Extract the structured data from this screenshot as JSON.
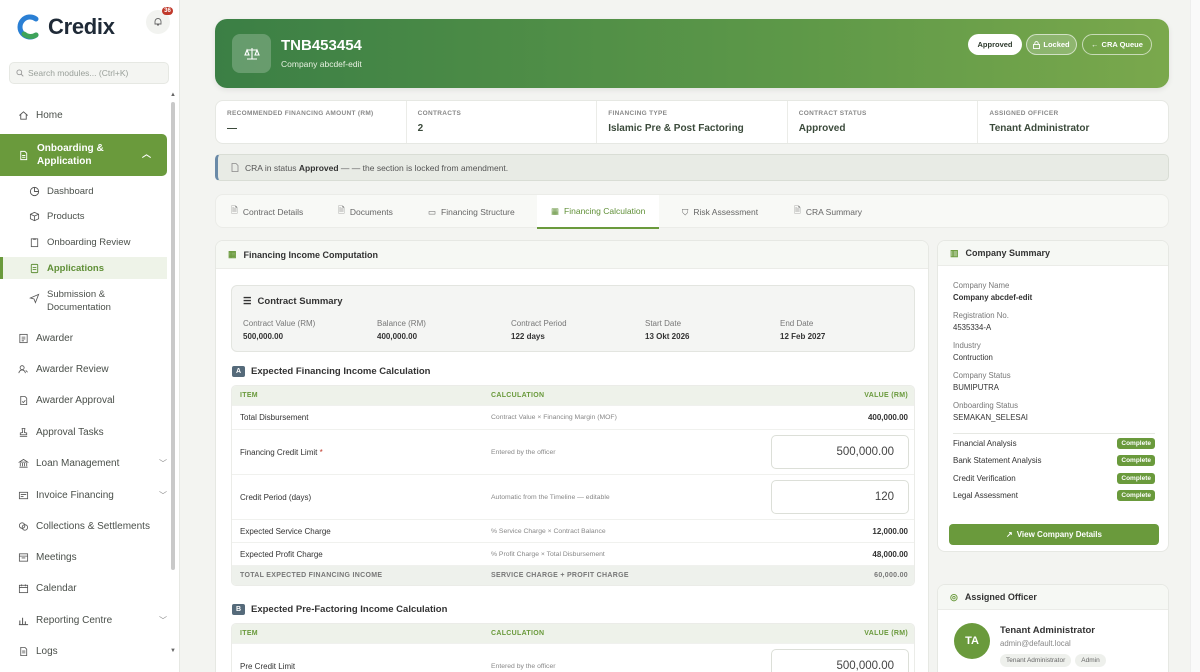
{
  "brand": {
    "name": "Credix",
    "notification_count": "36"
  },
  "search": {
    "placeholder": "Search modules... (Ctrl+K)"
  },
  "nav": {
    "home": "Home",
    "group_active": "Onboarding & Application",
    "sub": {
      "dashboard": "Dashboard",
      "products": "Products",
      "onboarding_review": "Onboarding Review",
      "applications": "Applications",
      "submission": "Submission & Documentation"
    },
    "awarder": "Awarder",
    "awarder_review": "Awarder Review",
    "awarder_approval": "Awarder Approval",
    "approval_tasks": "Approval Tasks",
    "loan_management": "Loan Management",
    "invoice_financing": "Invoice Financing",
    "collections": "Collections & Settlements",
    "meetings": "Meetings",
    "calendar": "Calendar",
    "reporting": "Reporting Centre",
    "logs": "Logs"
  },
  "hero": {
    "title": "TNB453454",
    "subtitle": "Company abcdef-edit",
    "approved_btn": "Approved",
    "locked_btn": "Locked",
    "queue_btn": "CRA Queue"
  },
  "stats": [
    {
      "label": "RECOMMENDED FINANCING AMOUNT (RM)",
      "value": "—"
    },
    {
      "label": "CONTRACTS",
      "value": "2"
    },
    {
      "label": "FINANCING TYPE",
      "value": "Islamic Pre & Post Factoring"
    },
    {
      "label": "CONTRACT STATUS",
      "value": "Approved"
    },
    {
      "label": "ASSIGNED OFFICER",
      "value": "Tenant Administrator"
    }
  ],
  "notice": {
    "prefix": "CRA in status",
    "status": "Approved",
    "suffix": "— — the section is locked from amendment."
  },
  "tabs": [
    "Contract Details",
    "Documents",
    "Financing Structure",
    "Financing Calculation",
    "Risk Assessment",
    "CRA Summary"
  ],
  "main": {
    "title": "Financing Income Computation",
    "contract_summary": {
      "title": "Contract Summary",
      "cols": [
        {
          "label": "Contract Value (RM)",
          "value": "500,000.00"
        },
        {
          "label": "Balance (RM)",
          "value": "400,000.00"
        },
        {
          "label": "Contract Period",
          "value": "122 days"
        },
        {
          "label": "Start Date",
          "value": "13 Okt 2026"
        },
        {
          "label": "End Date",
          "value": "12 Feb 2027"
        }
      ]
    },
    "section_a": {
      "badge": "A",
      "title": "Expected Financing Income Calculation",
      "headers": [
        "ITEM",
        "CALCULATION",
        "VALUE (RM)"
      ],
      "rows": [
        {
          "item": "Total Disbursement",
          "calc": "Contract Value × Financing Margin (MOF)",
          "value": "400,000.00"
        },
        {
          "item": "Financing Credit Limit",
          "calc": "Entered by the officer",
          "value": "500,000.00"
        },
        {
          "item": "Credit Period (days)",
          "calc": "Automatic from the Timeline — editable",
          "value": "120"
        },
        {
          "item": "Expected Service Charge",
          "calc": "% Service Charge × Contract Balance",
          "value": "12,000.00"
        },
        {
          "item": "Expected Profit Charge",
          "calc": "% Profit Charge × Total Disbursement",
          "value": "48,000.00"
        }
      ],
      "total": {
        "item": "TOTAL EXPECTED FINANCING INCOME",
        "calc": "SERVICE CHARGE + PROFIT CHARGE",
        "value": "60,000.00"
      }
    },
    "section_b": {
      "badge": "B",
      "title": "Expected Pre-Factoring Income Calculation",
      "headers": [
        "ITEM",
        "CALCULATION",
        "VALUE (RM)"
      ],
      "rows": [
        {
          "item": "Pre Credit Limit",
          "calc": "Entered by the officer",
          "value": "500,000.00"
        }
      ]
    }
  },
  "company": {
    "title": "Company Summary",
    "fields": [
      {
        "label": "Company Name",
        "value": "Company abcdef-edit"
      },
      {
        "label": "Registration No.",
        "value": "4535334-A"
      },
      {
        "label": "Industry",
        "value": "Contruction"
      },
      {
        "label": "Company Status",
        "value": "BUMIPUTRA"
      },
      {
        "label": "Onboarding Status",
        "value": "SEMAKAN_SELESAI"
      }
    ],
    "checks": [
      {
        "label": "Financial Analysis",
        "status": "Complete"
      },
      {
        "label": "Bank Statement Analysis",
        "status": "Complete"
      },
      {
        "label": "Credit Verification",
        "status": "Complete"
      },
      {
        "label": "Legal Assessment",
        "status": "Complete"
      }
    ],
    "button": "View Company Details"
  },
  "officer": {
    "title": "Assigned Officer",
    "initials": "TA",
    "name": "Tenant Administrator",
    "email": "admin@default.local",
    "tags": [
      "Tenant Administrator",
      "Admin"
    ]
  },
  "colors": {
    "accent": "#6a9a3c",
    "hero_start": "#3b7f45",
    "hero_end": "#7aa84c"
  }
}
